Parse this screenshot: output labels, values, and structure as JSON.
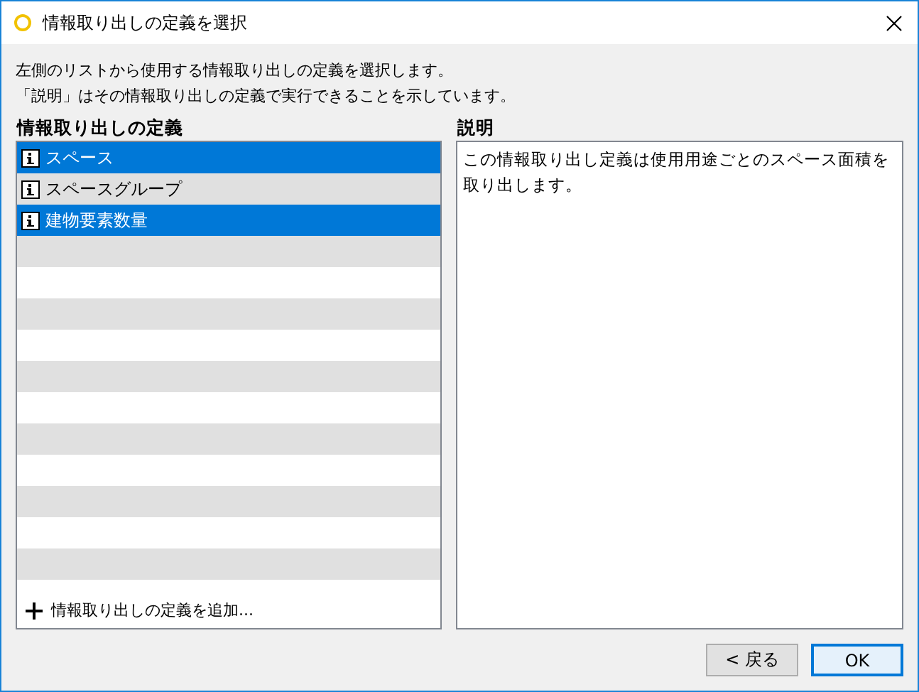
{
  "window": {
    "title": "情報取り出しの定義を選択"
  },
  "intro": [
    "左側のリストから使用する情報取り出しの定義を選択します。",
    "「説明」はその情報取り出しの定義で実行できることを示しています。"
  ],
  "definitions": {
    "heading": "情報取り出しの定義",
    "items": [
      {
        "label": "スペース",
        "selected": true
      },
      {
        "label": "スペースグループ",
        "selected": false
      },
      {
        "label": "建物要素数量",
        "selected": true
      }
    ],
    "add_link": "情報取り出しの定義を追加..."
  },
  "description": {
    "heading": "説明",
    "text": "この情報取り出し定義は使用用途ごとのスペース面積を取り出します。"
  },
  "buttons": [
    {
      "label": "< 戻る",
      "default": false
    },
    {
      "label": "OK",
      "default": true
    }
  ]
}
